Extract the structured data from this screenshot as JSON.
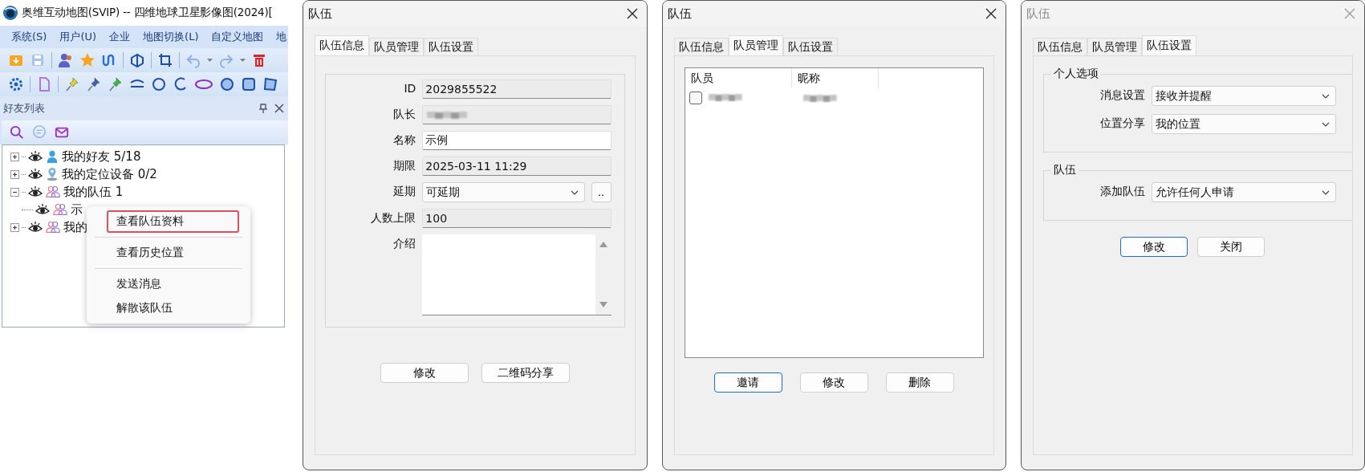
{
  "app": {
    "title": "奥维互动地图(SVIP) -- 四维地球卫星影像图(2024)[",
    "menu": [
      "系统(S)",
      "用户(U)",
      "企业",
      "地图切换(L)",
      "自定义地图",
      "地"
    ],
    "panel": {
      "title": "好友列表"
    },
    "tree": [
      {
        "label": "我的好友 5/18",
        "kind": "friends",
        "expanded": false
      },
      {
        "label": "我的定位设备 0/2",
        "kind": "devices",
        "expanded": false
      },
      {
        "label": "我的队伍 1",
        "kind": "team",
        "expanded": true,
        "children": [
          {
            "label": "示",
            "kind": "team"
          }
        ]
      },
      {
        "label": "我的",
        "kind": "team",
        "expanded": false
      }
    ],
    "context_menu": {
      "groups": [
        [
          {
            "label": "查看队伍资料",
            "selected": true
          }
        ],
        [
          {
            "label": "查看历史位置",
            "selected": false
          }
        ],
        [
          {
            "label": "发送消息",
            "selected": false
          },
          {
            "label": "解散该队伍",
            "selected": false
          }
        ]
      ]
    }
  },
  "dialogs": [
    {
      "kind": "info",
      "title": "队伍",
      "active": true,
      "tabs": [
        {
          "label": "队伍信息",
          "selected": true
        },
        {
          "label": "队员管理",
          "selected": false
        },
        {
          "label": "队伍设置",
          "selected": false
        }
      ],
      "fields": [
        {
          "label": "ID",
          "kind": "readonly",
          "value": "2029855522"
        },
        {
          "label": "队长",
          "kind": "redacted"
        },
        {
          "label": "名称",
          "kind": "text",
          "value": "示例"
        },
        {
          "label": "期限",
          "kind": "readonly",
          "value": "2025-03-11 11:29"
        },
        {
          "label": "延期",
          "kind": "select",
          "value": "可延期",
          "extra": ".."
        },
        {
          "label": "人数上限",
          "kind": "readonly",
          "value": "100"
        },
        {
          "label": "介绍",
          "kind": "textarea"
        }
      ],
      "buttons": [
        {
          "label": "修改",
          "default": false
        },
        {
          "label": "二维码分享",
          "default": false
        }
      ]
    },
    {
      "kind": "members",
      "title": "队伍",
      "active": true,
      "tabs": [
        {
          "label": "队伍信息",
          "selected": false
        },
        {
          "label": "队员管理",
          "selected": true
        },
        {
          "label": "队伍设置",
          "selected": false
        }
      ],
      "columns": [
        "队员",
        "昵称"
      ],
      "rows": [
        {
          "checked": false
        }
      ],
      "buttons": [
        {
          "label": "邀请",
          "default": true
        },
        {
          "label": "修改",
          "default": false
        },
        {
          "label": "删除",
          "default": false
        }
      ]
    },
    {
      "kind": "settings",
      "title": "队伍",
      "active": false,
      "tabs": [
        {
          "label": "队伍信息",
          "selected": false
        },
        {
          "label": "队员管理",
          "selected": false
        },
        {
          "label": "队伍设置",
          "selected": true
        }
      ],
      "groups": [
        {
          "title": "个人选项",
          "fields": [
            {
              "label": "消息设置",
              "value": "接收并提醒"
            },
            {
              "label": "位置分享",
              "value": "我的位置"
            }
          ]
        },
        {
          "title": "队伍",
          "fields": [
            {
              "label": "添加队伍",
              "value": "允许任何人申请"
            }
          ]
        }
      ],
      "buttons": [
        {
          "label": "修改",
          "default": true
        },
        {
          "label": "关闭",
          "default": false
        }
      ]
    }
  ]
}
